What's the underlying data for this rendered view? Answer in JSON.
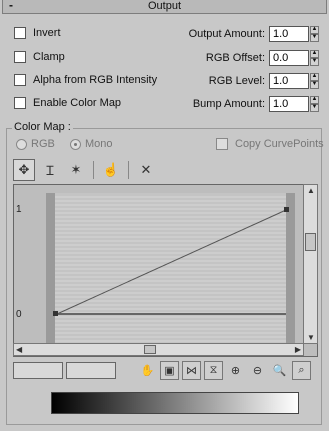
{
  "rollout": {
    "title": "Output",
    "collapse": "-"
  },
  "options": {
    "invert": "Invert",
    "clamp": "Clamp",
    "alpha_from_rgb": "Alpha from RGB Intensity",
    "enable_color_map": "Enable Color Map"
  },
  "fields": {
    "output_amount": {
      "label": "Output Amount:",
      "value": "1.0"
    },
    "rgb_offset": {
      "label": "RGB Offset:",
      "value": "0.0"
    },
    "rgb_level": {
      "label": "RGB Level:",
      "value": "1.0"
    },
    "bump_amount": {
      "label": "Bump Amount:",
      "value": "1.0"
    }
  },
  "color_map": {
    "title": "Color Map :",
    "radio_rgb": "RGB",
    "radio_mono": "Mono",
    "copy_curve_points": "Copy CurvePoints",
    "y_tick_1": "1",
    "y_tick_0": "0",
    "curve_color": "#555555",
    "gradient_start": "#000000",
    "gradient_end": "#ffffff"
  },
  "toolbar": {
    "icons": [
      "move-icon",
      "scale-point-icon",
      "insert-point-icon",
      "hand-icon",
      "delete-icon"
    ]
  },
  "bottom_toolbar": {
    "icons": [
      "pan-icon",
      "zoom-extents-icon",
      "zoom-horizontal-icon",
      "zoom-vertical-icon",
      "zoom-plus-icon",
      "zoom-minus-icon",
      "zoom-icon",
      "zoom-region-icon"
    ]
  }
}
